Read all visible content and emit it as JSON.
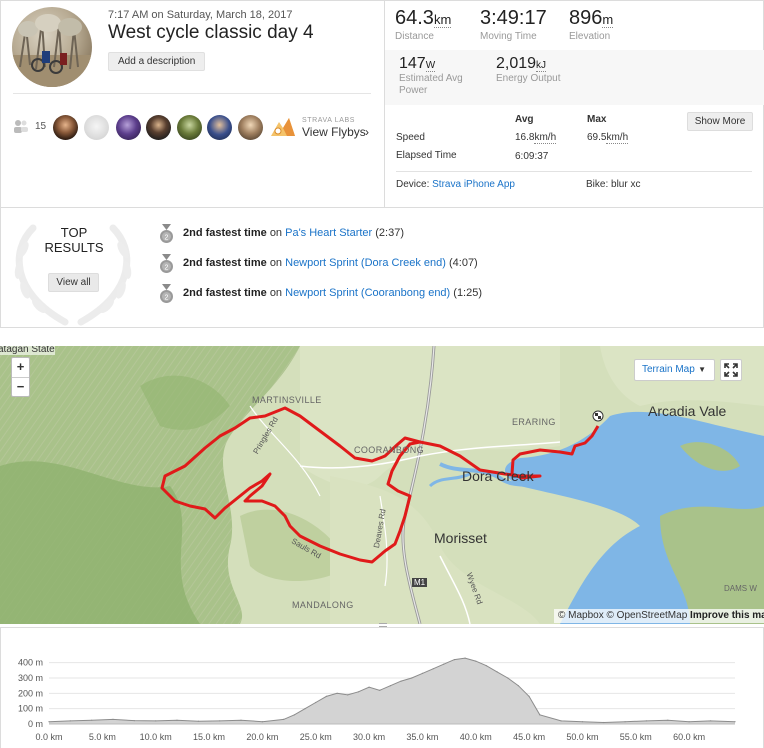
{
  "activity": {
    "date": "7:17 AM on Saturday, March 18, 2017",
    "title": "West cycle classic day 4",
    "add_description": "Add a description"
  },
  "kudos": {
    "count": "15"
  },
  "flyby": {
    "labs": "STRAVA LABS",
    "label": "View Flybys",
    "chevron": "›"
  },
  "stats": {
    "distance": {
      "value": "64.3",
      "unit": "km",
      "label": "Distance"
    },
    "moving_time": {
      "value": "3:49:17",
      "label": "Moving Time"
    },
    "elevation": {
      "value": "896",
      "unit": "m",
      "label": "Elevation"
    },
    "power": {
      "value": "147",
      "unit": "W",
      "label": "Estimated Avg Power"
    },
    "energy": {
      "value": "2,019",
      "unit": "kJ",
      "label": "Energy Output"
    }
  },
  "table": {
    "avg_header": "Avg",
    "max_header": "Max",
    "show_more": "Show More",
    "speed_label": "Speed",
    "speed_avg": "16.8",
    "speed_max": "69.5",
    "speed_unit": "km/h",
    "elapsed_label": "Elapsed Time",
    "elapsed_avg": "6:09:37"
  },
  "device": {
    "label": "Device:",
    "value": "Strava iPhone App"
  },
  "bike": {
    "label": "Bike:",
    "value": "blur xc"
  },
  "top_results": {
    "title_line1": "TOP",
    "title_line2": "RESULTS",
    "view_all": "View all",
    "efforts": [
      {
        "rank": "2nd fastest time",
        "on": "on",
        "segment": "Pa's Heart Starter",
        "time": "(2:37)"
      },
      {
        "rank": "2nd fastest time",
        "on": "on",
        "segment": "Newport Sprint (Dora Creek end)",
        "time": "(4:07)"
      },
      {
        "rank": "2nd fastest time",
        "on": "on",
        "segment": "Newport Sprint (Cooranbong end)",
        "time": "(1:25)"
      }
    ]
  },
  "map": {
    "zoom_in": "+",
    "zoom_out": "−",
    "map_type": "Terrain Map",
    "attribution_mapbox": "© Mapbox",
    "attribution_osm": "© OpenStreetMap",
    "attribution_improve": "Improve this map",
    "labels": {
      "watagan": "atagan State",
      "martinsville": "MARTINSVILLE",
      "cooranbong": "COORANBONG",
      "eraring": "ERARING",
      "arcadia_vale": "Arcadia Vale",
      "dora_creek": "Dora Creek",
      "morisset": "Morisset",
      "mandalong": "MANDALONG",
      "m1": "M1",
      "pringles_rd": "Pringles Rd",
      "sauls_rd": "Sauls Rd",
      "deaves_rd": "Deaves Rd",
      "wyee_rd": "Wyee Rd",
      "dams_w": "DAMS W"
    },
    "route_color": "#e01a1a",
    "water_color": "#7fb6e6"
  },
  "elevation_chart": {
    "y_ticks": [
      "400 m",
      "300 m",
      "200 m",
      "100 m",
      "0 m"
    ],
    "x_ticks": [
      "0.0 km",
      "5.0 km",
      "10.0 km",
      "15.0 km",
      "20.0 km",
      "25.0 km",
      "30.0 km",
      "35.0 km",
      "40.0 km",
      "45.0 km",
      "50.0 km",
      "55.0 km",
      "60.0 km"
    ]
  },
  "chart_data": {
    "type": "area",
    "xlabel": "",
    "ylabel": "",
    "x": [
      0,
      2,
      4,
      6,
      8,
      10,
      12,
      14,
      16,
      18,
      20,
      22,
      23,
      24,
      25,
      26,
      27,
      28,
      29,
      30,
      31,
      32,
      33,
      34,
      35,
      36,
      37,
      38,
      39,
      40,
      41,
      42,
      43,
      44,
      45,
      46,
      48,
      50,
      52,
      54,
      56,
      58,
      60,
      62,
      64.3
    ],
    "values": [
      15,
      20,
      25,
      30,
      22,
      20,
      25,
      18,
      20,
      25,
      15,
      30,
      60,
      100,
      140,
      180,
      200,
      190,
      210,
      240,
      220,
      250,
      280,
      300,
      330,
      360,
      390,
      420,
      430,
      410,
      380,
      340,
      300,
      250,
      180,
      60,
      20,
      15,
      10,
      15,
      20,
      25,
      15,
      20,
      15
    ],
    "xlim": [
      0,
      64.3
    ],
    "ylim": [
      0,
      450
    ],
    "fill_color": "#d3d3d3",
    "line_color": "#8c8c8c"
  }
}
